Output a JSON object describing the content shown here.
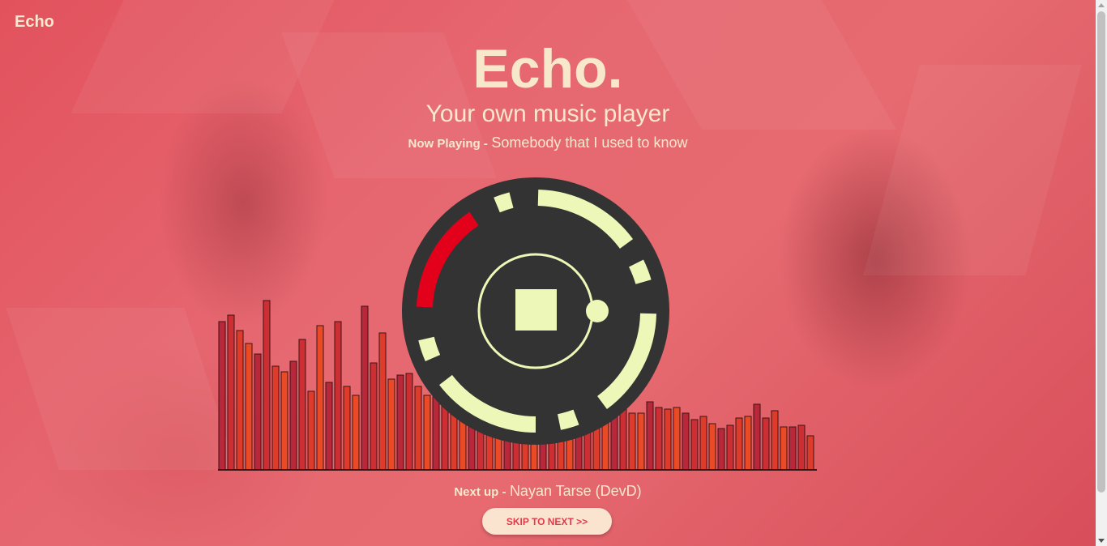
{
  "brand": "Echo",
  "hero": {
    "title": "Echo.",
    "subtitle": "Your own music player"
  },
  "now_playing": {
    "label": "Now Playing -",
    "song": "Somebody that I used to know"
  },
  "next_up": {
    "label": "Next up -",
    "song": "Nayan Tarse (DevD)"
  },
  "skip_button": "SKIP TO NEXT >>",
  "player": {
    "state": "playing",
    "control_icon": "stop-icon",
    "progress_color": "#e3001b",
    "ring_color": "#ecf7b8",
    "disc_color": "#333333"
  },
  "visualizer": {
    "levels": [
      0.83,
      0.87,
      0.78,
      0.71,
      0.65,
      0.95,
      0.58,
      0.55,
      0.61,
      0.73,
      0.44,
      0.81,
      0.49,
      0.83,
      0.47,
      0.42,
      0.92,
      0.6,
      0.77,
      0.51,
      0.53,
      0.54,
      0.47,
      0.42,
      0.41,
      0.42,
      0.41,
      0.4,
      0.39,
      0.38,
      0.34,
      0.33,
      0.34,
      0.32,
      0.3,
      0.31,
      0.3,
      0.29,
      0.28,
      0.27,
      0.28,
      0.3,
      0.33,
      0.36,
      0.37,
      0.36,
      0.32,
      0.32,
      0.38,
      0.35,
      0.34,
      0.35,
      0.32,
      0.28,
      0.3,
      0.26,
      0.23,
      0.25,
      0.29,
      0.3,
      0.37,
      0.29,
      0.33,
      0.24,
      0.24,
      0.25,
      0.19
    ],
    "colors": [
      "#b8283a",
      "#cc2e33",
      "#de3b2b",
      "#ec4a24"
    ]
  },
  "icons": {
    "scroll_up": "chevron-up-icon",
    "scroll_down": "chevron-down-icon"
  }
}
